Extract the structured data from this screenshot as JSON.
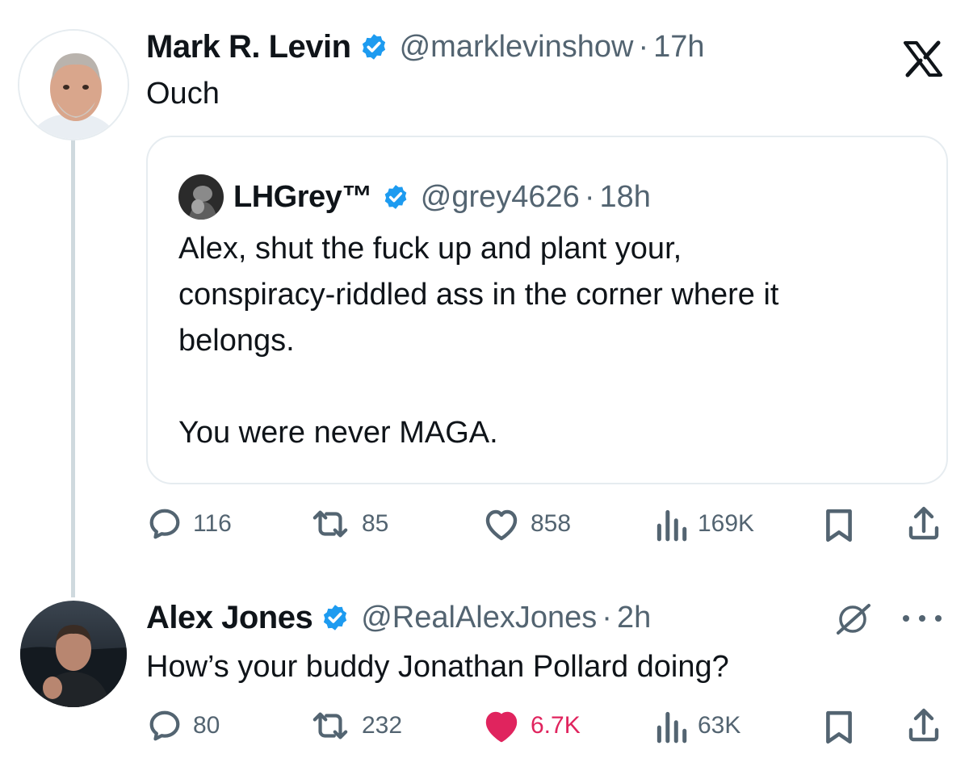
{
  "post1": {
    "name": "Mark R. Levin",
    "handle": "@marklevinshow",
    "sep": "·",
    "time": "17h",
    "text": "Ouch",
    "quote": {
      "name": "LHGrey™",
      "handle": "@grey4626",
      "sep": "·",
      "time": "18h",
      "lines": [
        "Alex, shut the fuck up and plant your,",
        "conspiracy-riddled ass in the corner where it",
        "belongs.",
        "You were never MAGA."
      ]
    },
    "actions": {
      "replies": "116",
      "reposts": "85",
      "likes": "858",
      "views": "169K"
    }
  },
  "post2": {
    "name": "Alex Jones",
    "handle": "@RealAlexJones",
    "sep": "·",
    "time": "2h",
    "text": "How’s your buddy Jonathan Pollard doing?",
    "actions": {
      "replies": "80",
      "reposts": "232",
      "likes": "6.7K",
      "views": "63K"
    },
    "liked": true
  },
  "colors": {
    "verified": "#1d9bf0",
    "like": "#e0245e",
    "muted": "#536471"
  },
  "icons": [
    "x-logo-icon",
    "verified-badge-icon",
    "reply-icon",
    "repost-icon",
    "heart-icon",
    "views-icon",
    "bookmark-icon",
    "share-icon",
    "grok-icon",
    "more-icon"
  ]
}
